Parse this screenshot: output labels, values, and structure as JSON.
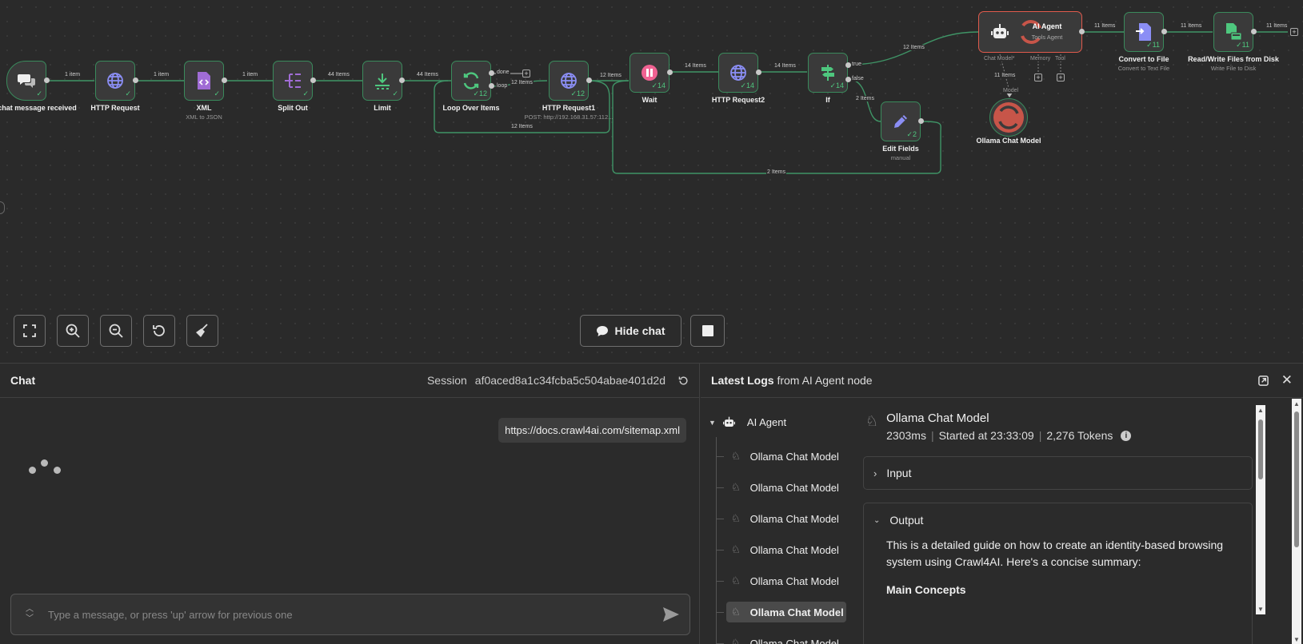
{
  "canvas": {
    "nodes": {
      "trigger": {
        "label": "When chat message received"
      },
      "http1": {
        "label": "HTTP Request"
      },
      "xml": {
        "label": "XML",
        "sub": "XML to JSON"
      },
      "split": {
        "label": "Split Out"
      },
      "limit": {
        "label": "Limit"
      },
      "loop": {
        "label": "Loop Over Items",
        "count": "12",
        "out_done": "done",
        "out_loop": "loop"
      },
      "http_req1": {
        "label": "HTTP Request1",
        "sub": "POST: http://192.168.31.57:112...",
        "count": "12"
      },
      "wait": {
        "label": "Wait",
        "count": "14"
      },
      "http2": {
        "label": "HTTP Request2",
        "count": "14"
      },
      "if": {
        "label": "If",
        "count": "14",
        "out_true": "true",
        "out_false": "false"
      },
      "edit": {
        "label": "Edit Fields",
        "sub": "manual",
        "count": "2"
      },
      "agent": {
        "label": "AI Agent",
        "sub": "Tools Agent",
        "port_chat": "Chat Model*",
        "port_memory": "Memory",
        "port_tool": "Tool"
      },
      "ollama": {
        "label": "Ollama Chat Model",
        "model_label": "Model"
      },
      "convert": {
        "label": "Convert to File",
        "sub": "Convert to Text File",
        "count": "11"
      },
      "rw": {
        "label": "Read/Write Files from Disk",
        "sub": "Write File to Disk",
        "count": "11"
      }
    },
    "edges": {
      "e1": "1 item",
      "e2": "1 item",
      "e3": "1 item",
      "e4": "44 Items",
      "e5": "44 Items",
      "e6": "12 Items",
      "e7": "12 Items",
      "e8": "12 Items",
      "e9": "14 Items",
      "e10": "14 Items",
      "e11": "12 Items",
      "e12": "2 Items",
      "e13": "2 Items",
      "e14": "11 Items",
      "e15": "11 Items",
      "e16": "11 Items",
      "e17": "11 Items"
    },
    "hide_chat_label": "Hide chat"
  },
  "chat": {
    "title": "Chat",
    "session_label": "Session",
    "session_id": "af0aced8a1c34fcba5c504abae401d2d",
    "user_message": "https://docs.crawl4ai.com/sitemap.xml",
    "input_placeholder": "Type a message, or press 'up' arrow for previous one"
  },
  "logs": {
    "title_bold": "Latest Logs",
    "title_rest": "from AI Agent node",
    "root": "AI Agent",
    "items": [
      "Ollama Chat Model",
      "Ollama Chat Model",
      "Ollama Chat Model",
      "Ollama Chat Model",
      "Ollama Chat Model",
      "Ollama Chat Model",
      "Ollama Chat Model"
    ],
    "detail": {
      "name": "Ollama Chat Model",
      "duration": "2303ms",
      "started": "Started at 23:33:09",
      "tokens": "2,276 Tokens",
      "input_label": "Input",
      "output_label": "Output",
      "output_text": "This is a detailed guide on how to create an identity-based browsing system using Crawl4AI. Here's a concise summary:",
      "output_heading": "Main Concepts"
    }
  },
  "colors": {
    "success": "#3a8a5c",
    "error": "#e05a4c",
    "edge": "#3f9466"
  }
}
